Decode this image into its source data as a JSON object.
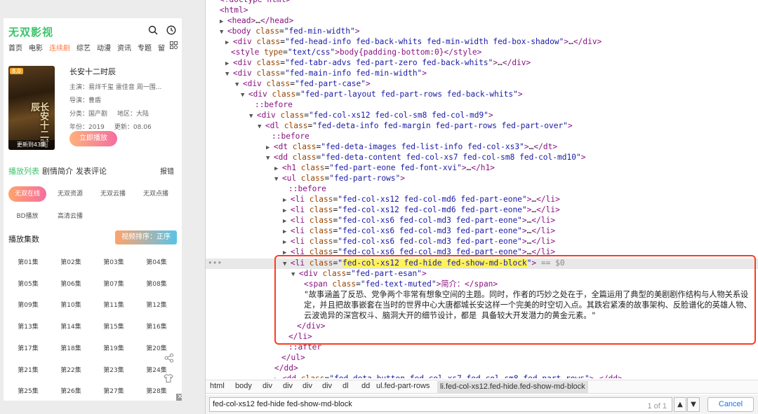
{
  "site": {
    "logo": "无双影视",
    "nav": [
      "首页",
      "电影",
      "连续剧",
      "综艺",
      "动漫",
      "资讯",
      "专题",
      "留"
    ],
    "active_nav": "连续剧"
  },
  "movie": {
    "badge": "8.0",
    "poster_art": "长安十二时辰",
    "update_text": "更新到43集",
    "title": "长安十二时辰",
    "cast": "主演：易烊千玺 雷佳音 周一围...",
    "director": "导演：曹盾",
    "category": "分类：国产剧",
    "region": "地区：大陆",
    "year": "年份：2019",
    "updated": "更新：08.06",
    "play_label": "立即播放"
  },
  "tabs": {
    "items": [
      "播放列表",
      "剧情简介",
      "发表评论"
    ],
    "report": "报错"
  },
  "sources": [
    "无双在线",
    "无双资源",
    "无双云播",
    "无双点播",
    "BD播放",
    "高清云播"
  ],
  "episodes": {
    "heading": "播放集数",
    "sort_label": "视频排序：正序",
    "items": [
      "第01集",
      "第02集",
      "第03集",
      "第04集",
      "第05集",
      "第06集",
      "第07集",
      "第08集",
      "第09集",
      "第10集",
      "第11集",
      "第12集",
      "第13集",
      "第14集",
      "第15集",
      "第16集",
      "第17集",
      "第18集",
      "第19集",
      "第20集",
      "第21集",
      "第22集",
      "第23集",
      "第24集",
      "第25集",
      "第26集",
      "第27集",
      "第28集"
    ]
  },
  "devtools": {
    "lines": [
      "<!doctype html>",
      "<html>",
      "<head>…</head>",
      "<body class=\"fed-min-width\">",
      "<div class=\"fed-head-info fed-back-whits fed-min-width fed-box-shadow\">…</div>",
      "<style type=\"text/css\">body{padding-bottom:0}</style>",
      "<div class=\"fed-tabr-advs fed-part-zero fed-back-whits\">…</div>",
      "<div class=\"fed-main-info fed-min-width\">",
      "<div class=\"fed-part-case\">",
      "<div class=\"fed-part-layout fed-part-rows fed-back-whits\">",
      "::before",
      "<div class=\"fed-col-xs12 fed-col-sm8 fed-col-md9\">",
      "<dl class=\"fed-deta-info fed-margin fed-part-rows fed-part-over\">",
      "::before",
      "<dt class=\"fed-deta-images fed-list-info fed-col-xs3\">…</dt>",
      "<dd class=\"fed-deta-content fed-col-xs7 fed-col-sm8 fed-col-md10\">",
      "<h1 class=\"fed-part-eone fed-font-xvi\">…</h1>",
      "<ul class=\"fed-part-rows\">",
      "::before",
      "<li class=\"fed-col-xs12 fed-col-md6 fed-part-eone\">…</li>",
      "<li class=\"fed-col-xs12 fed-col-md6 fed-part-eone\">…</li>",
      "<li class=\"fed-col-xs6 fed-col-md3 fed-part-eone\">…</li>",
      "<li class=\"fed-col-xs6 fed-col-md3 fed-part-eone\">…</li>",
      "<li class=\"fed-col-xs6 fed-col-md3 fed-part-eone\">…</li>",
      "<li class=\"fed-col-xs6 fed-col-md3 fed-part-eone\">…</li>",
      "<li class=\"fed-col-xs12 fed-hide fed-show-md-block\"> == $0",
      "<div class=\"fed-part-esan\">",
      "<span class=\"fed-text-muted\">简介：</span>",
      "\"故事涵盖了反恐、党争两个非常有想象空间的主题。同时，作者的巧妙之处在于，全篇运用了典型的美剧剧作结构与人物关系设",
      "定，并且把故事嵌套在当时的世界中心大唐都城长安这样一个完美的时空切入点。其跌宕紧凑的故事架构、反脸谱化的英雄人物、",
      "云波诡异的深宫权斗、脑洞大开的细节设计，都是 具备较大开发潜力的黄金元素。\"",
      "</div>",
      "</li>",
      "::after",
      "</ul>",
      "</dd>",
      "<dd class=\"fed-deta-button fed-col-xs7 fed-col-sm8 fed-part-rows\">…</dd>"
    ],
    "selected_class": "fed-col-xs12 fed-hide fed-show-md-block",
    "breadcrumbs": [
      "html",
      "body",
      "div",
      "div",
      "div",
      "div",
      "dl",
      "dd",
      "ul.fed-part-rows",
      "li.fed-col-xs12.fed-hide.fed-show-md-block"
    ],
    "search_value": "fed-col-xs12 fed-hide fed-show-md-block",
    "search_count": "1 of 1",
    "cancel_label": "Cancel"
  },
  "colors": {
    "brand_green": "#3dc46b",
    "highlight_box": "#ff3b1f",
    "search_highlight": "#fff25b"
  },
  "icons": [
    "search-icon",
    "history-icon",
    "grid-icon",
    "share-icon",
    "shirt-icon",
    "close-icon"
  ]
}
